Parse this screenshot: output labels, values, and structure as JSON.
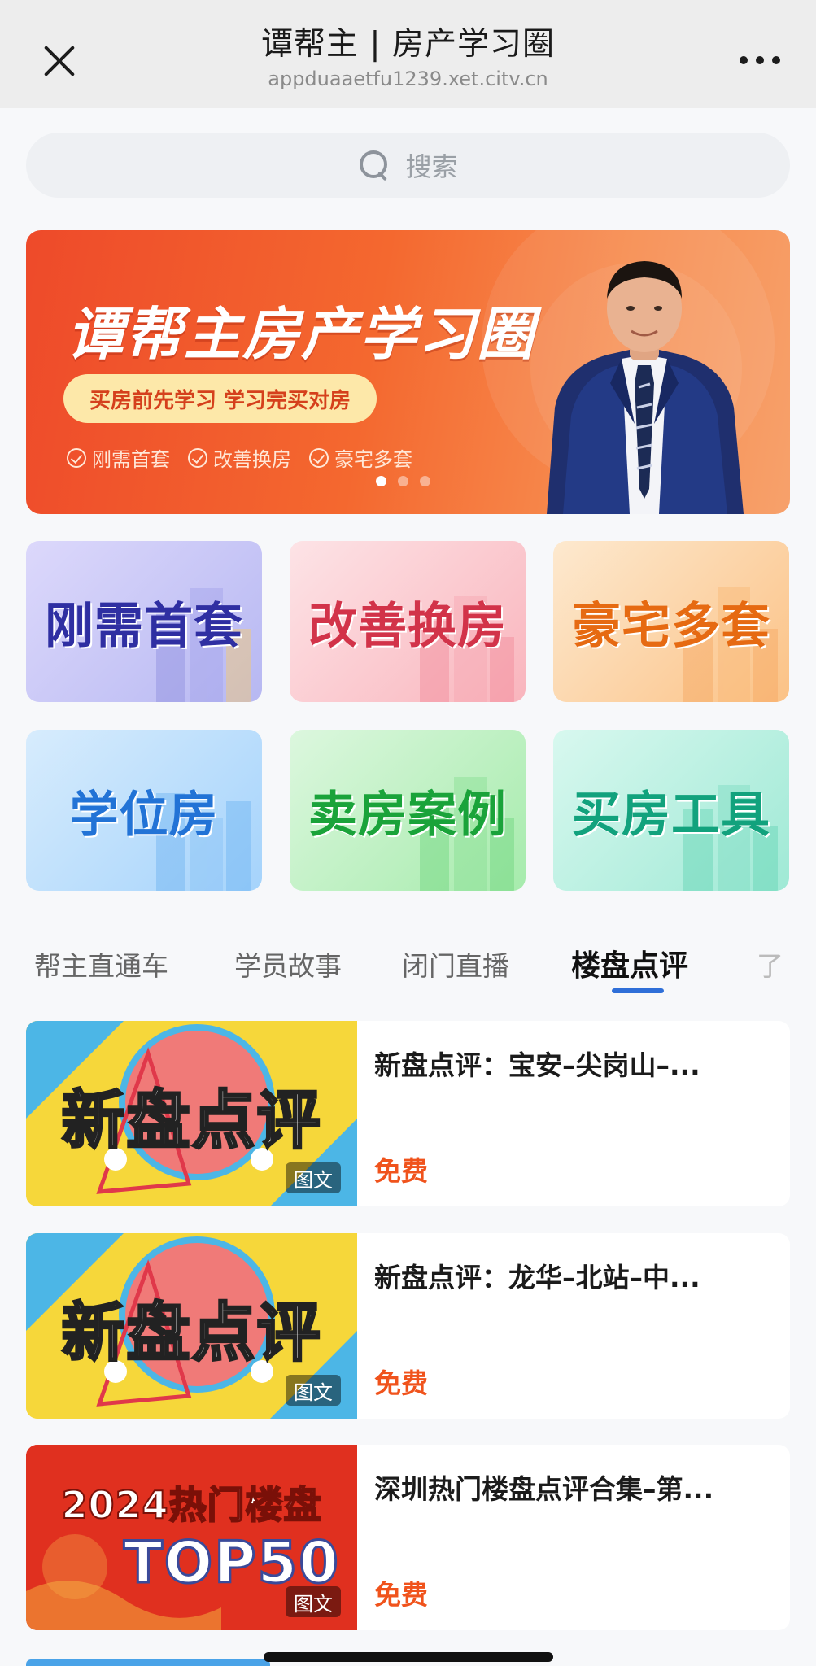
{
  "header": {
    "title": "谭帮主 | 房产学习圈",
    "url": "appduaaetfu1239.xet.citv.cn"
  },
  "search": {
    "placeholder": "搜索"
  },
  "banner": {
    "title": "谭帮主房产学习圈",
    "slogan": "买房前先学习 学习完买对房",
    "tags": [
      "刚需首套",
      "改善换房",
      "豪宅多套"
    ],
    "slide_count": 3,
    "active_slide": 1
  },
  "categories": [
    {
      "label": "刚需首套",
      "color": "#2f2fa2"
    },
    {
      "label": "改善换房",
      "color": "#d23349"
    },
    {
      "label": "豪宅多套",
      "color": "#e66a12"
    },
    {
      "label": "学位房",
      "color": "#2273d6"
    },
    {
      "label": "卖房案例",
      "color": "#1aa33a"
    },
    {
      "label": "买房工具",
      "color": "#12a27d"
    }
  ],
  "tabs": [
    {
      "label": "帮主直通车",
      "active": false
    },
    {
      "label": "学员故事",
      "active": false
    },
    {
      "label": "闭门直播",
      "active": false
    },
    {
      "label": "楼盘点评",
      "active": true
    },
    {
      "label": "了",
      "active": false
    }
  ],
  "items": [
    {
      "title": "新盘点评：宝安–尖岗山–...",
      "price": "免费",
      "badge": "图文",
      "thumb_text": "新盘点评"
    },
    {
      "title": "新盘点评：龙华–北站–中...",
      "price": "免费",
      "badge": "图文",
      "thumb_text": "新盘点评"
    },
    {
      "title": "深圳热门楼盘点评合集–第...",
      "price": "免费",
      "badge": "图文",
      "thumb_line1": "2024热门楼盘",
      "thumb_line2": "TOP50"
    }
  ],
  "colors": {
    "accent_tab": "#2f6fd8",
    "price": "#f0531c",
    "banner": "#ee4a2a"
  }
}
